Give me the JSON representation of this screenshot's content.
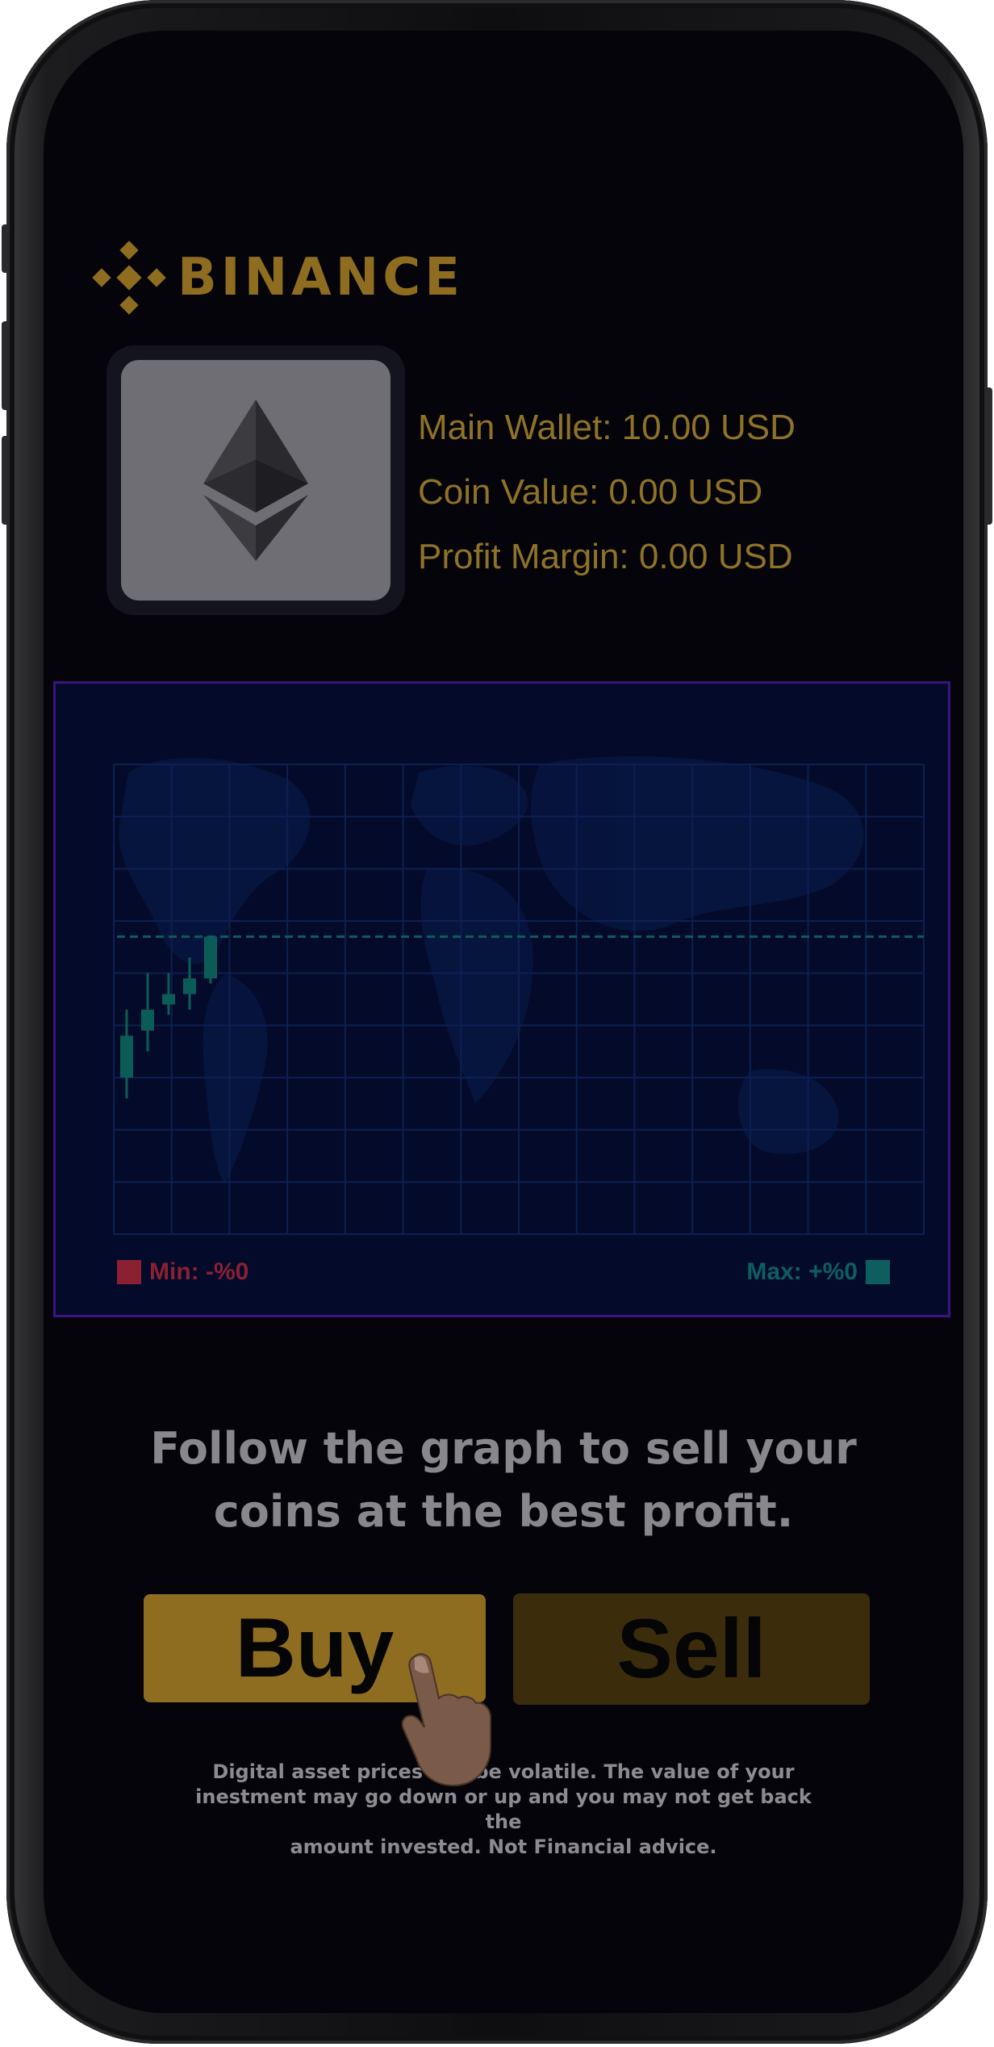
{
  "brand": {
    "name": "BINANCE",
    "color": "#8e6d20"
  },
  "coin": {
    "icon": "ethereum-icon"
  },
  "wallet": {
    "main_wallet": "Main Wallet: 10.00 USD",
    "coin_value": "Coin Value: 0.00 USD",
    "profit_margin": "Profit Margin: 0.00 USD"
  },
  "chart": {
    "min_label": "Min: -%0",
    "max_label": "Max: +%0",
    "min_color": "#8a2032",
    "max_color": "#0e5e60"
  },
  "chart_data": {
    "type": "candlestick",
    "candles": [
      {
        "open": 3.0,
        "close": 3.8,
        "low": 2.6,
        "high": 4.3
      },
      {
        "open": 3.9,
        "close": 4.3,
        "low": 3.5,
        "high": 5.0
      },
      {
        "open": 4.4,
        "close": 4.6,
        "low": 4.2,
        "high": 5.0
      },
      {
        "open": 4.6,
        "close": 4.9,
        "low": 4.3,
        "high": 5.3
      },
      {
        "open": 4.9,
        "close": 5.7,
        "low": 4.8,
        "high": 5.7
      }
    ],
    "reference_level": 5.7,
    "ylim": [
      0,
      9
    ],
    "grid": true,
    "grid_columns": 14,
    "grid_rows": 9
  },
  "instruction": {
    "line1": "Follow the graph to sell your",
    "line2": "coins at the best profit."
  },
  "actions": {
    "buy_label": "Buy",
    "sell_label": "Sell",
    "buy_color": "#8e6d20",
    "sell_color": "#3b2d0c"
  },
  "pointer": {
    "icon": "pointing-hand-icon"
  },
  "disclaimer": {
    "line1": "Digital asset prices can be volatile. The value of your",
    "line2": "inestment may go down or up and you may not get back the",
    "line3": "amount invested. Not Financial advice."
  }
}
